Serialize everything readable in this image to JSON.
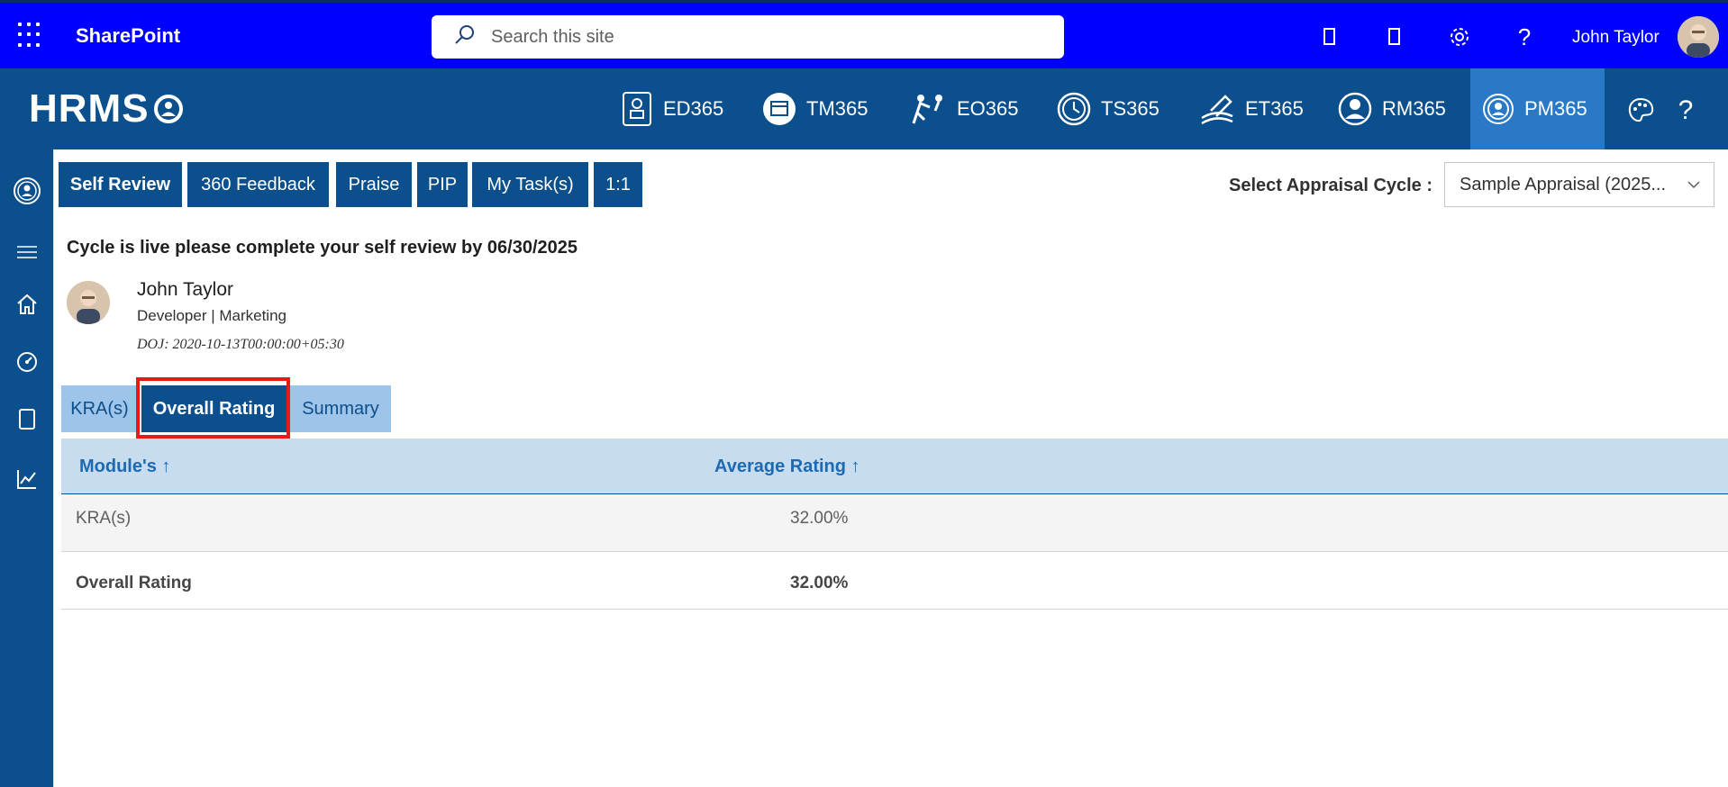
{
  "sharepoint": {
    "title": "SharePoint",
    "search_placeholder": "Search this site",
    "user_name": "John Taylor"
  },
  "hrms": {
    "logo_text": "HRMS",
    "modules": [
      {
        "label": "ED365"
      },
      {
        "label": "TM365"
      },
      {
        "label": "EO365"
      },
      {
        "label": "TS365"
      },
      {
        "label": "ET365"
      },
      {
        "label": "RM365"
      },
      {
        "label": "PM365",
        "active": true
      }
    ]
  },
  "tabs": [
    {
      "label": "Self Review",
      "active": true
    },
    {
      "label": "360 Feedback"
    },
    {
      "label": "Praise"
    },
    {
      "label": "PIP"
    },
    {
      "label": "My Task(s)"
    },
    {
      "label": "1:1"
    }
  ],
  "appraisal": {
    "label": "Select Appraisal Cycle :",
    "selected": "Sample Appraisal (2025..."
  },
  "notice": "Cycle is live please complete your self review by 06/30/2025",
  "employee": {
    "name": "John Taylor",
    "role": "Developer | Marketing",
    "doj": "DOJ: 2020-10-13T00:00:00+05:30"
  },
  "subtabs": [
    {
      "label": "KRA(s)"
    },
    {
      "label": "Overall Rating",
      "active": true
    },
    {
      "label": "Summary"
    }
  ],
  "table": {
    "headers": [
      "Module's ↑",
      "Average Rating ↑"
    ],
    "rows": [
      {
        "module": "KRA(s)",
        "rating": "32.00%"
      }
    ],
    "total": {
      "module": "Overall Rating",
      "rating": "32.00%"
    }
  },
  "colors": {
    "sharepoint_bar": "#0000ff",
    "hrms_bar": "#0b4f8c",
    "active_module": "#2a79c6",
    "highlight": "#e8191b"
  }
}
